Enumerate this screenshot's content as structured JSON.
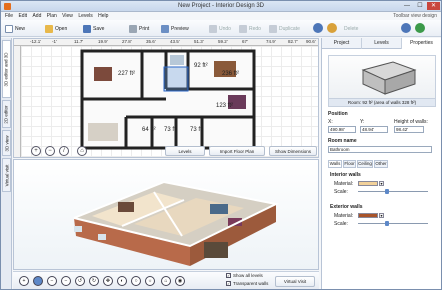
{
  "window": {
    "title": "New Project - Interior Design 3D",
    "min": "—",
    "max": "☐",
    "close": "✕"
  },
  "menu": {
    "items": [
      "File",
      "Edit",
      "Add",
      "Plan",
      "View",
      "Levels",
      "Help"
    ],
    "hint": "Toolbar view design"
  },
  "toolbar": {
    "new": "New",
    "open": "Open",
    "save": "Save",
    "print": "Print",
    "preview": "Preview",
    "undo": "Undo",
    "redo": "Redo",
    "duplicate": "Duplicate",
    "delete": "Delete"
  },
  "vertical_tabs": [
    "3D editor and 3D",
    "2D editor",
    "3D view",
    "Virtual visit"
  ],
  "ruler": {
    "top": [
      "-12.1'",
      "-1'",
      "11.7'",
      "19.9'",
      "27.8'",
      "35.6'",
      "43.5'",
      "51.3'",
      "59.2'",
      "67'",
      "74.9'",
      "82.7'",
      "90.6'"
    ]
  },
  "rooms": [
    {
      "name": "227 ft²"
    },
    {
      "name": "92 ft²"
    },
    {
      "name": "236 ft²"
    },
    {
      "name": "64 ft²"
    },
    {
      "name": "73 ft²"
    },
    {
      "name": "73 ft²"
    },
    {
      "name": "123 ft²"
    }
  ],
  "plan_buttons": {
    "levels": "Levels",
    "import": "Import Floor Plan",
    "dimensions": "Show Dimensions"
  },
  "bottom": {
    "show_all_levels": "Show all levels",
    "transparent_walls": "Transparent walls",
    "virtual_visit": "Virtual Visit"
  },
  "panel": {
    "tabs": [
      "Project",
      "Levels",
      "Properties"
    ],
    "active_tab": "Properties",
    "preview_caption": "Room: 92 ft² (area of walls 328 ft²)",
    "position": {
      "label": "Position",
      "x_label": "X:",
      "y_label": "Y:",
      "h_label": "Height of walls:",
      "x": "490.98'",
      "y": "48.94'",
      "h": "98.42'"
    },
    "room_name": {
      "label": "Room name",
      "value": "Bathroom"
    },
    "sub_tabs": [
      "Walls",
      "Floor",
      "Ceiling",
      "Other"
    ],
    "interior": {
      "title": "Interior walls",
      "material_label": "Material:",
      "scale_label": "Scale:",
      "color": "#f2d19a"
    },
    "exterior": {
      "title": "Exterior walls",
      "material_label": "Material:",
      "scale_label": "Scale:",
      "color": "#a8542a"
    }
  },
  "colors": {
    "accent": "#5d88c8",
    "titlebar": "#c8d7ec"
  }
}
